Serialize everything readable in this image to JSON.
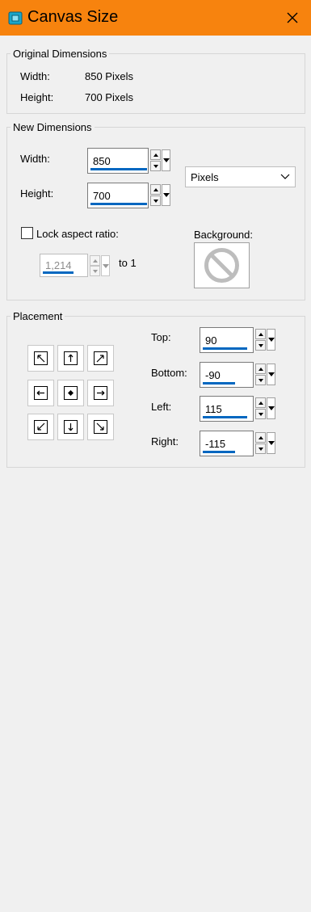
{
  "window": {
    "title": "Canvas Size",
    "title_icon": "canvas-size-app-icon",
    "close_icon": "close-icon",
    "accent_color": "#f7830e"
  },
  "original": {
    "group_label": "Original Dimensions",
    "width_label": "Width:",
    "width_value": "850 Pixels",
    "height_label": "Height:",
    "height_value": "700 Pixels"
  },
  "new_dimensions": {
    "group_label": "New Dimensions",
    "width_label": "Width:",
    "width_value": "850",
    "height_label": "Height:",
    "height_value": "700",
    "units_selected": "Pixels",
    "lock_label": "Lock aspect ratio:",
    "lock_checked": false,
    "ratio_value": "1,214",
    "ratio_suffix": "to 1",
    "background_label": "Background:",
    "background_icon": "no-symbol-icon"
  },
  "placement": {
    "group_label": "Placement",
    "buttons": [
      {
        "name": "top-left",
        "icon": "arrow-up-left-icon"
      },
      {
        "name": "top-center",
        "icon": "arrow-up-icon"
      },
      {
        "name": "top-right",
        "icon": "arrow-up-right-icon"
      },
      {
        "name": "middle-left",
        "icon": "arrow-left-icon"
      },
      {
        "name": "center",
        "icon": "center-dot-icon"
      },
      {
        "name": "middle-right",
        "icon": "arrow-right-icon"
      },
      {
        "name": "bottom-left",
        "icon": "arrow-down-left-icon"
      },
      {
        "name": "bottom-center",
        "icon": "arrow-down-icon"
      },
      {
        "name": "bottom-right",
        "icon": "arrow-down-right-icon"
      }
    ],
    "top_label": "Top:",
    "top_value": "90",
    "bottom_label": "Bottom:",
    "bottom_value": "-90",
    "left_label": "Left:",
    "left_value": "115",
    "right_label": "Right:",
    "right_value": "-115"
  }
}
